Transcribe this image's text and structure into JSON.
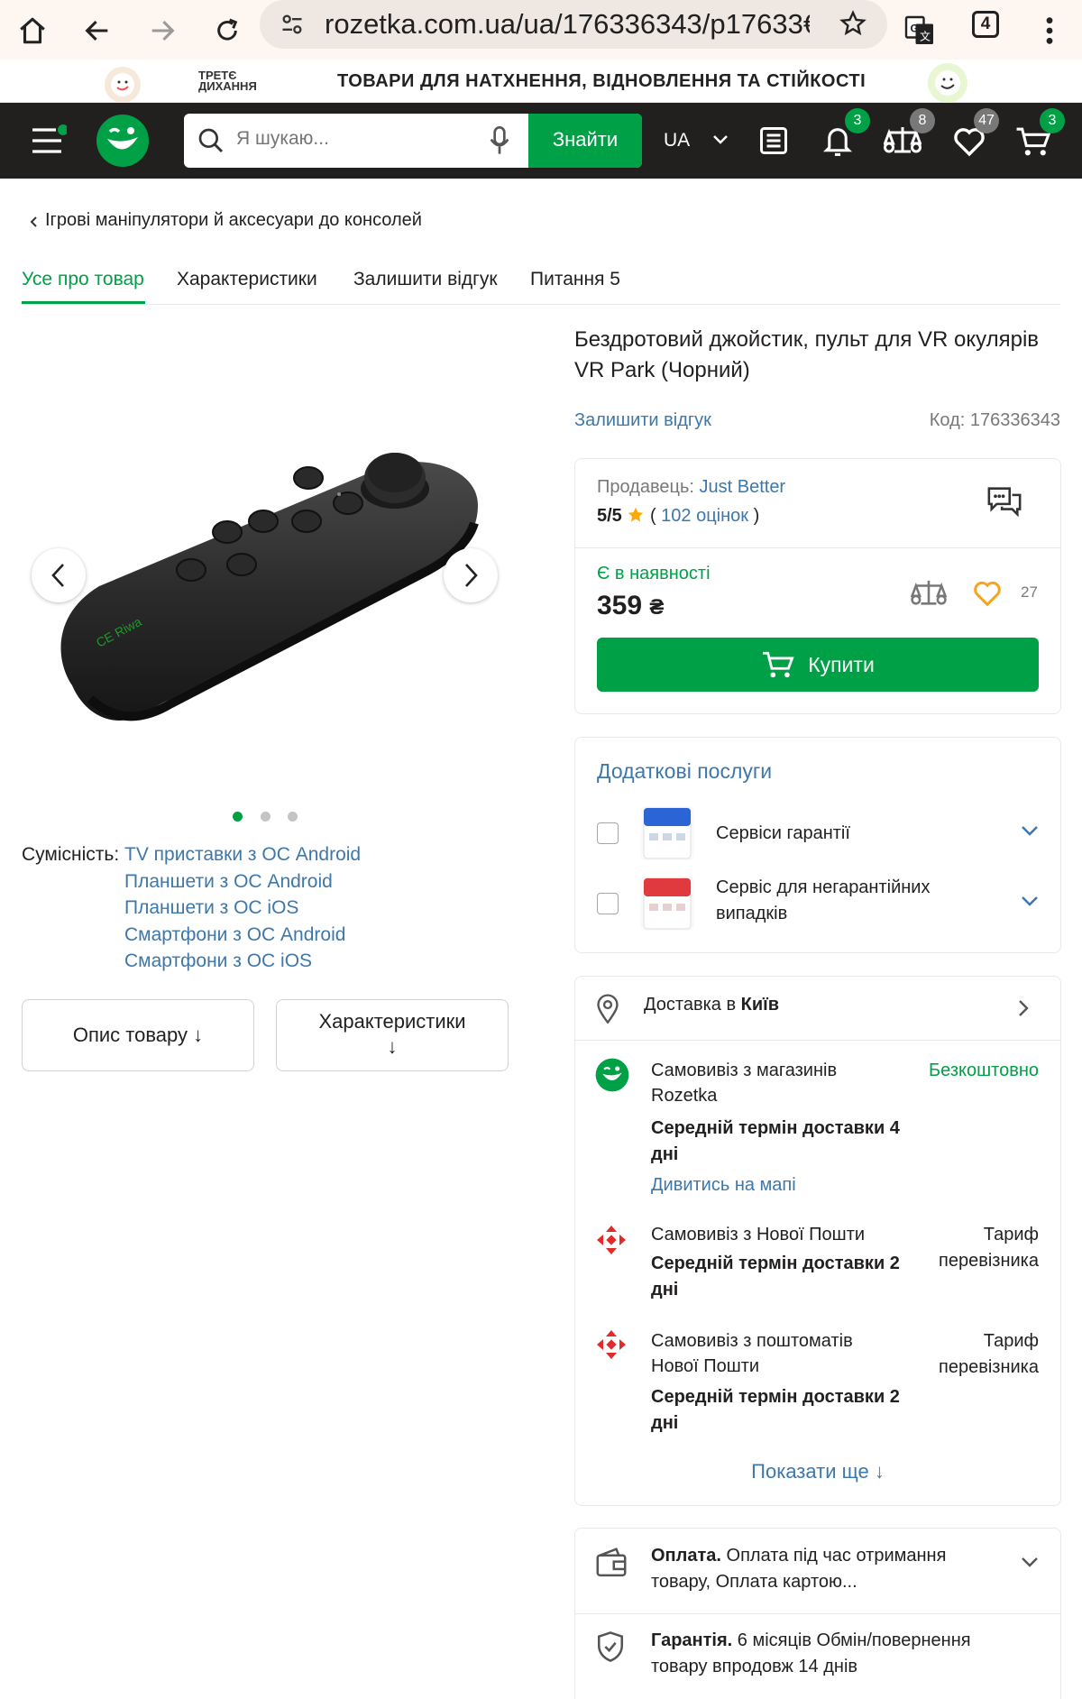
{
  "browser": {
    "url": "rozetka.com.ua/ua/176336343/p17633€",
    "tab_count": "4"
  },
  "promo": {
    "logo_text_line1": "ТРЕТЄ",
    "logo_text_line2": "ДИХАННЯ",
    "text": "ТОВАРИ ДЛЯ НАТХНЕННЯ, ВІДНОВЛЕННЯ ТА СТІЙКОСТІ"
  },
  "header": {
    "search_placeholder": "Я шукаю...",
    "search_button": "Знайти",
    "lang": "UA",
    "badges": {
      "notifications": "3",
      "compare": "8",
      "wishlist": "47",
      "cart": "3"
    }
  },
  "breadcrumb": "Ігрові маніпулятори й аксесуари до консолей",
  "tabs": [
    "Усе про товар",
    "Характеристики",
    "Залишити відгук",
    "Питання 5"
  ],
  "gallery": {
    "slides": 3,
    "active": 0
  },
  "compat": {
    "label": "Сумісність:",
    "items": [
      "TV приставки з ОС Android",
      "Планшети з ОС Android",
      "Планшети з ОС iOS",
      "Смартфони з ОС Android",
      "Смартфони з ОС iOS"
    ]
  },
  "buttons": {
    "description": "Опис товару ↓",
    "characteristics_line1": "Характеристики",
    "characteristics_line2": "↓"
  },
  "product": {
    "title": "Бездротовий джойстик, пульт для VR окулярів VR Park (Чорний)",
    "leave_review": "Залишити відгук",
    "code_label": "Код:",
    "code": "176336343"
  },
  "seller": {
    "label": "Продавець:",
    "name": "Just Better",
    "rating": "5/5",
    "reviews_open": "(",
    "reviews": "102 оцінок",
    "reviews_close": ")"
  },
  "offer": {
    "availability": "Є в наявності",
    "price": "359",
    "currency": "₴",
    "wish_count": "27",
    "buy": "Купити"
  },
  "services": {
    "title": "Додаткові послуги",
    "items": [
      {
        "label": "Сервіси гарантії"
      },
      {
        "label_line1": "Сервіс для негарантійних",
        "label_line2": "випадків"
      }
    ]
  },
  "delivery": {
    "title": "Доставка в",
    "city": "Київ",
    "options": [
      {
        "name_line1": "Самовивіз з магазинів",
        "name_line2": "Rozetka",
        "term_line1": "Середній термін доставки 4",
        "term_line2": "дні",
        "price": "Безкоштовно",
        "link": "Дивитись на мапі"
      },
      {
        "name_line1": "Самовивіз з Нової Пошти",
        "term_line1": "Середній термін доставки 2",
        "term_line2": "дні",
        "price_line1": "Тариф",
        "price_line2": "перевізника"
      },
      {
        "name_line1": "Самовивіз з поштоматів",
        "name_line2": "Нової Пошти",
        "term_line1": "Середній термін доставки 2",
        "term_line2": "дні",
        "price_line1": "Тариф",
        "price_line2": "перевізника"
      }
    ],
    "show_more": "Показати ще ↓"
  },
  "payment": {
    "label": "Оплата.",
    "text_line1": "Оплата під час отримання",
    "text_line2": "товару, Оплата картою..."
  },
  "warranty": {
    "label": "Гарантія.",
    "text_line1": "6 місяців Обмін/повернення",
    "text_line2": "товару впродовж 14 днів"
  },
  "colors": {
    "brand_green": "#00a046",
    "link_blue": "#3e77aa",
    "header_dark": "#221f1f",
    "star": "#ffa900",
    "heart": "#f8a41b"
  }
}
